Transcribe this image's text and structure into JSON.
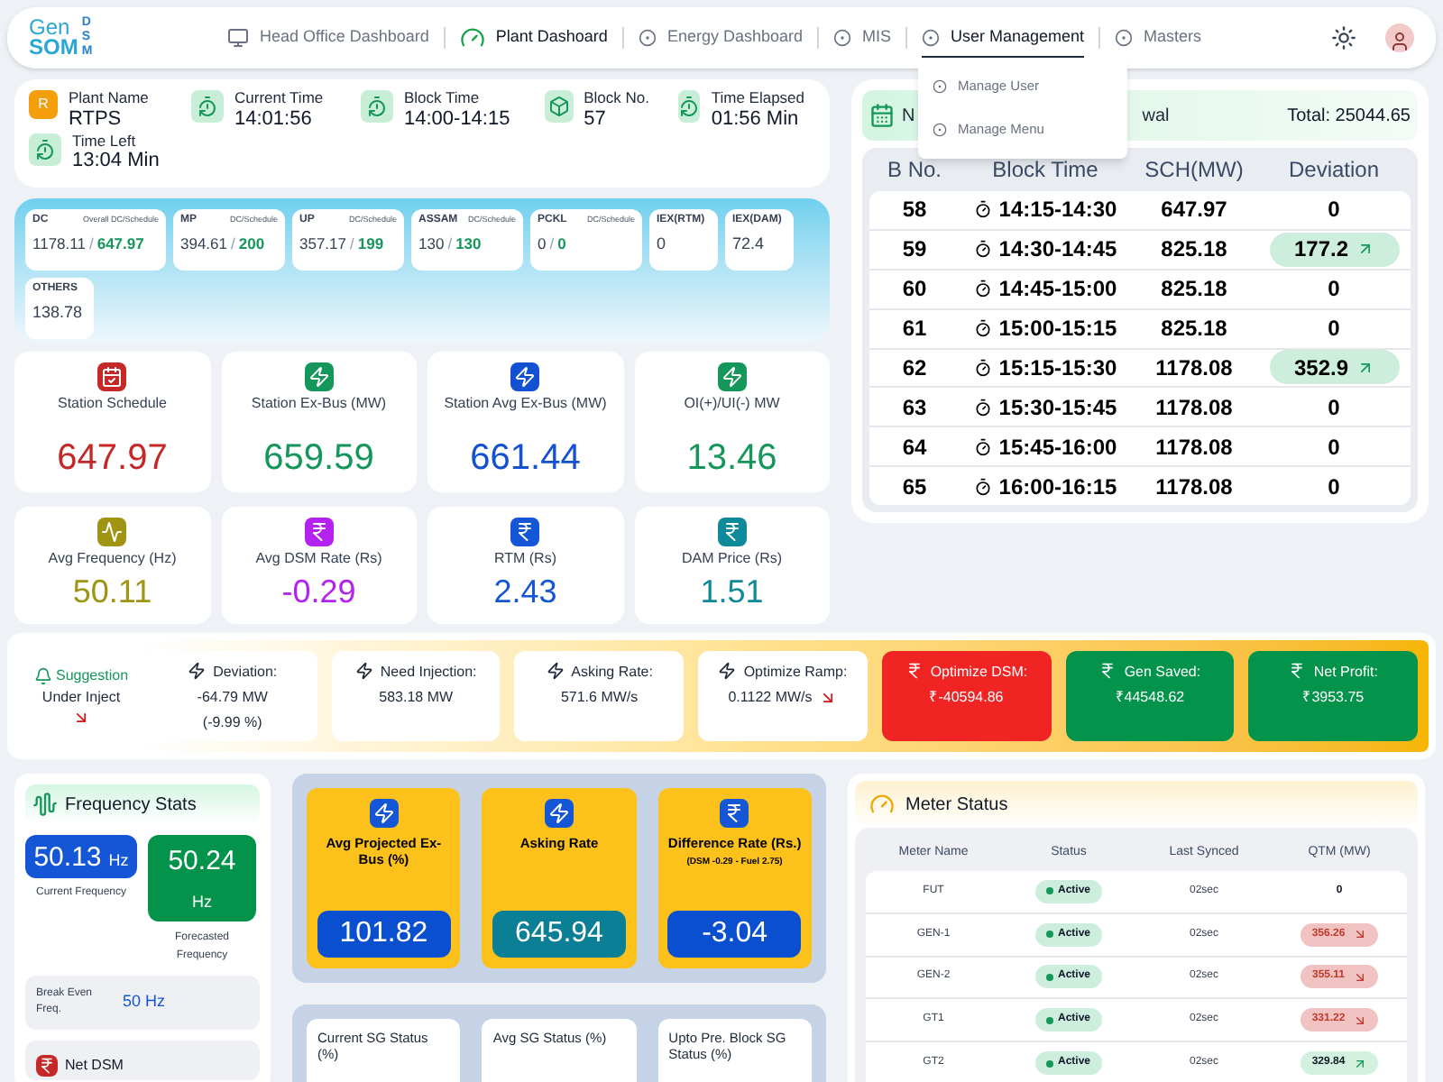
{
  "header": {
    "logo": [
      "Gen",
      "SOM",
      "DSM"
    ],
    "nav": [
      {
        "label": "Head Office Dashboard",
        "kind": "monitor",
        "selected": false
      },
      {
        "label": "Plant Dashoard",
        "kind": "gauge",
        "selected": false
      },
      {
        "label": "Energy Dashboard",
        "kind": "dot",
        "selected": false
      },
      {
        "label": "MIS",
        "kind": "dot",
        "selected": false
      },
      {
        "label": "User Management",
        "kind": "dot",
        "selected": true,
        "expanded": true,
        "submenu": [
          "Manage User",
          "Manage Menu"
        ]
      },
      {
        "label": "Masters",
        "kind": "dot",
        "selected": false
      }
    ]
  },
  "plant_info": [
    {
      "label": "Plant Name",
      "value": "RTPS",
      "kind": "badge",
      "badge": "R"
    },
    {
      "label": "Current Time",
      "value": "14:01:56",
      "kind": "clock"
    },
    {
      "label": "Block Time",
      "value": "14:00-14:15",
      "kind": "clock"
    },
    {
      "label": "Block No.",
      "value": "57",
      "kind": "cube"
    },
    {
      "label": "Time Elapsed",
      "value": "01:56 Min",
      "kind": "clock"
    },
    {
      "label": "Time Left",
      "value": "13:04 Min",
      "kind": "clock"
    }
  ],
  "dc_panel": {
    "separator": "/",
    "cards": [
      {
        "name": "DC",
        "sub": "Overall DC/Schedule",
        "values": [
          "1178.11",
          "647.97"
        ],
        "kind": "pair"
      },
      {
        "name": "MP",
        "sub": "DC/Schedule",
        "values": [
          "394.61",
          "200"
        ],
        "kind": "pair"
      },
      {
        "name": "UP",
        "sub": "DC/Schedule",
        "values": [
          "357.17",
          "199"
        ],
        "kind": "pair"
      },
      {
        "name": "ASSAM",
        "sub": "DC/Schedule",
        "values": [
          "130",
          "130"
        ],
        "kind": "pair"
      },
      {
        "name": "PCKL",
        "sub": "DC/Schedule",
        "values": [
          "0",
          "0"
        ],
        "kind": "pair"
      },
      {
        "name": "IEX(RTM)",
        "values": [
          "0"
        ],
        "kind": "single"
      },
      {
        "name": "IEX(DAM)",
        "values": [
          "72.4"
        ],
        "kind": "single"
      },
      {
        "name": "OTHERS",
        "values": [
          "138.78"
        ],
        "kind": "single"
      }
    ]
  },
  "stats": [
    {
      "title": "Station Schedule",
      "value": "647.97",
      "color": "#c62828",
      "kind": "calendar"
    },
    {
      "title": "Station Ex-Bus (MW)",
      "value": "659.59",
      "color": "#15965a",
      "kind": "bolt"
    },
    {
      "title": "Station Avg Ex-Bus (MW)",
      "value": "661.44",
      "color": "#1450d2",
      "kind": "bolt"
    },
    {
      "title": "OI(+)/UI(-) MW",
      "value": "13.46",
      "color": "#15965a",
      "kind": "bolt"
    },
    {
      "title": "Avg Frequency (Hz)",
      "value": "50.11",
      "color": "#a09512",
      "kind": "wave"
    },
    {
      "title": "Avg DSM Rate (Rs)",
      "value": "-0.29",
      "color": "#b322f0",
      "kind": "rupee"
    },
    {
      "title": "RTM (Rs)",
      "value": "2.43",
      "color": "#1456d6",
      "kind": "rupee"
    },
    {
      "title": "DAM Price (Rs)",
      "value": "1.51",
      "color": "#0e8a9a",
      "kind": "rupee"
    }
  ],
  "schedule_table": {
    "title_parts": [
      "N",
      "wal"
    ],
    "total": "Total: 25044.65",
    "columns": [
      "B No.",
      "Block Time",
      "SCH(MW)",
      "Deviation"
    ],
    "rows": [
      {
        "block": "58",
        "time": "14:15-14:30",
        "sch": "647.97",
        "deviation": "0",
        "kind": "plain"
      },
      {
        "block": "59",
        "time": "14:30-14:45",
        "sch": "825.18",
        "deviation": "177.2",
        "kind": "rising"
      },
      {
        "block": "60",
        "time": "14:45-15:00",
        "sch": "825.18",
        "deviation": "0",
        "kind": "plain"
      },
      {
        "block": "61",
        "time": "15:00-15:15",
        "sch": "825.18",
        "deviation": "0",
        "kind": "plain"
      },
      {
        "block": "62",
        "time": "15:15-15:30",
        "sch": "1178.08",
        "deviation": "352.9",
        "kind": "rising"
      },
      {
        "block": "63",
        "time": "15:30-15:45",
        "sch": "1178.08",
        "deviation": "0",
        "kind": "plain"
      },
      {
        "block": "64",
        "time": "15:45-16:00",
        "sch": "1178.08",
        "deviation": "0",
        "kind": "plain"
      },
      {
        "block": "65",
        "time": "16:00-16:15",
        "sch": "1178.08",
        "deviation": "0",
        "kind": "plain"
      }
    ]
  },
  "suggestion": {
    "title": "Suggestion",
    "text": "Under Inject",
    "falling": true,
    "items": [
      {
        "label": "Deviation:",
        "value": "-64.79 MW",
        "note": "(-9.99 %)",
        "kind": "plain",
        "falling": false
      },
      {
        "label": "Need Injection:",
        "value": "583.18 MW",
        "kind": "plain",
        "falling": false
      },
      {
        "label": "Asking Rate:",
        "value": "571.6 MW/s",
        "kind": "plain",
        "falling": false
      },
      {
        "label": "Optimize Ramp:",
        "value": "0.1122 MW/s",
        "kind": "plain",
        "falling": true
      },
      {
        "label": "Optimize DSM:",
        "value": "₹-40594.86",
        "kind": "loss",
        "falling": false
      },
      {
        "label": "Gen Saved:",
        "value": "₹44548.62",
        "kind": "gain",
        "falling": false
      },
      {
        "label": "Net Profit:",
        "value": "₹3953.75",
        "kind": "gain",
        "falling": false
      }
    ]
  },
  "frequency": {
    "title": "Frequency Stats",
    "current": {
      "value": "50.13",
      "unit": "Hz",
      "label": "Current Frequency"
    },
    "forecast": {
      "value": "50.24",
      "unit": "Hz",
      "label": "Forecasted Frequency"
    },
    "break_even": {
      "label": "Break Even Freq.",
      "value": "50 Hz"
    },
    "net_dsm": "Net DSM"
  },
  "projections": [
    {
      "title": "Avg Projected Ex-Bus (%)",
      "value": "101.82",
      "color": "#0b4fd1",
      "kind": "bolt"
    },
    {
      "title": "Asking Rate",
      "value": "645.94",
      "color": "#0a7f95",
      "kind": "bolt"
    },
    {
      "title": "Difference Rate (Rs.)",
      "note": "(DSM -0.29 - Fuel 2.75)",
      "value": "-3.04",
      "color": "#0b4fd1",
      "kind": "rupee"
    }
  ],
  "sg_status": [
    "Current SG Status (%)",
    "Avg SG Status (%)",
    "Upto Pre. Block SG Status (%)"
  ],
  "meter": {
    "title": "Meter Status",
    "columns": [
      "Meter Name",
      "Status",
      "Last Synced",
      "QTM (MW)"
    ],
    "rows": [
      {
        "name": "FUT",
        "status": "Active",
        "active": true,
        "synced": "02sec",
        "qtm": "0",
        "kind": "plain"
      },
      {
        "name": "GEN-1",
        "status": "Active",
        "active": true,
        "synced": "02sec",
        "qtm": "356.26",
        "kind": "falling"
      },
      {
        "name": "GEN-2",
        "status": "Active",
        "active": true,
        "synced": "02sec",
        "qtm": "355.11",
        "kind": "falling"
      },
      {
        "name": "GT1",
        "status": "Active",
        "active": true,
        "synced": "02sec",
        "qtm": "331.22",
        "kind": "falling"
      },
      {
        "name": "GT2",
        "status": "Active",
        "active": true,
        "synced": "02sec",
        "qtm": "329.84",
        "kind": "rising"
      }
    ]
  }
}
